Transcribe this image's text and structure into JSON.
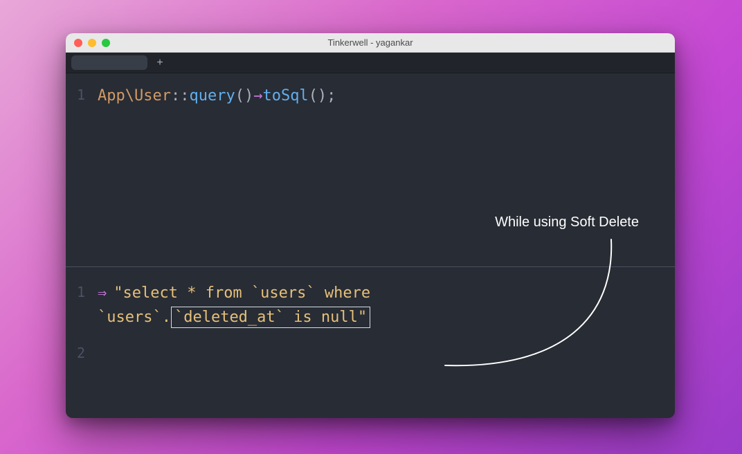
{
  "window": {
    "title": "Tinkerwell - yagankar"
  },
  "tabbar": {
    "add_label": "+"
  },
  "editor": {
    "lines": [
      {
        "num": "1",
        "tokens": {
          "ns": "App\\User",
          "scope": "::",
          "fn1": "query",
          "parens1": "()",
          "arrow": "→",
          "fn2": "toSql",
          "parens2": "();"
        }
      }
    ]
  },
  "output": {
    "lines": [
      {
        "num": "1",
        "arrow": "⇒",
        "part1": "\"select * from `users` where ",
        "part2_prefix": "`users`.",
        "highlighted": "`deleted_at` is null\"",
        "empty": false
      },
      {
        "num": "2",
        "empty": true
      }
    ]
  },
  "annotation": {
    "text": "While using Soft Delete"
  }
}
